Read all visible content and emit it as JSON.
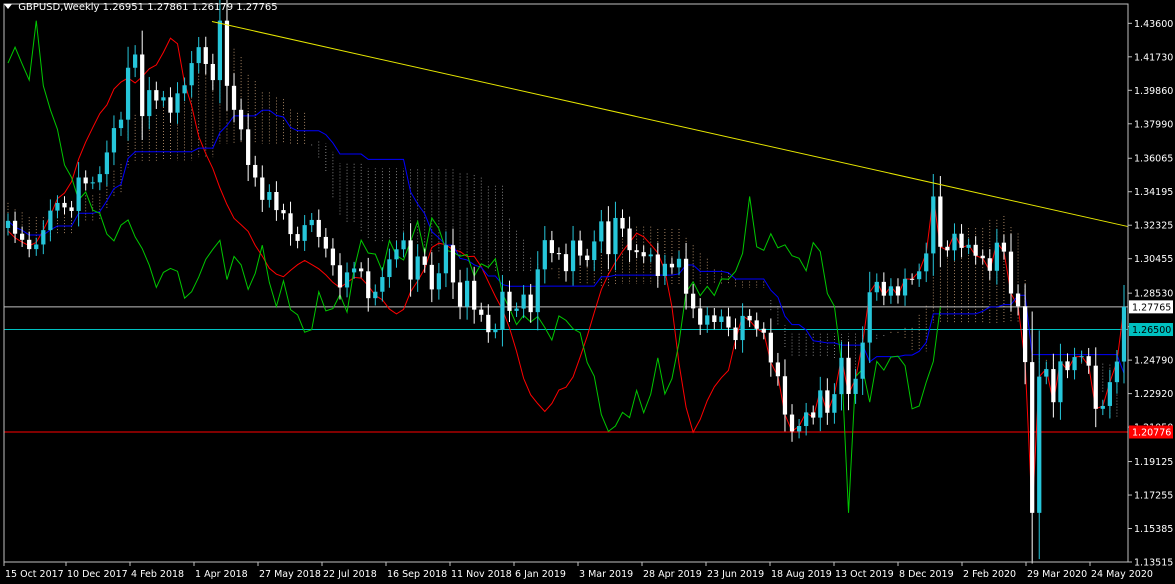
{
  "header": {
    "symbol": "GBPUSD,Weekly",
    "ohlc": "1.26951 1.27861 1.26179 1.27765"
  },
  "colors": {
    "background": "#000000",
    "frame": "#c0c0c0",
    "candle_up": "#26c6da",
    "candle_down": "#ffffff",
    "tenkan": "#ff0000",
    "kijun": "#0000ff",
    "chikou": "#00c800",
    "kumo_up": "#ffcc99",
    "kumo_down": "#c8c8c8",
    "trendline": "#e6e600",
    "bid_line": "#c0c0c0",
    "level_cyan": "#00c0c0",
    "level_red": "#ff0000"
  },
  "chart_data": {
    "type": "candlestick",
    "timeframe": "Weekly",
    "ylim": [
      1.13515,
      1.4468
    ],
    "y_ticks": [
      "1.43600",
      "1.41730",
      "1.39860",
      "1.37990",
      "1.36065",
      "1.34195",
      "1.32325",
      "1.30455",
      "1.28530",
      "1.26660",
      "1.24790",
      "1.22920",
      "1.21050",
      "1.19125",
      "1.17255",
      "1.15385",
      "1.13515"
    ],
    "x_labels": [
      "15 Oct 2017",
      "10 Dec 2017",
      "4 Feb 2018",
      "1 Apr 2018",
      "27 May 2018",
      "22 Jul 2018",
      "16 Sep 2018",
      "11 Nov 2018",
      "6 Jan 2019",
      "3 Mar 2019",
      "28 Apr 2019",
      "23 Jun 2019",
      "18 Aug 2019",
      "13 Oct 2019",
      "8 Dec 2019",
      "2 Feb 2020",
      "29 Mar 2020",
      "24 May 2020"
    ],
    "price_labels": {
      "current": "1.27765",
      "level_1": "1.26500",
      "level_2": "1.20776"
    },
    "levels": [
      {
        "name": "current",
        "value": 1.27765
      },
      {
        "name": "level_1",
        "value": 1.265
      },
      {
        "name": "level_2",
        "value": 1.20776
      }
    ],
    "trendline": [
      {
        "i": 0,
        "y": 1.437
      },
      {
        "i": 0,
        "y": 1.3225
      }
    ],
    "closes": [
      1.3257,
      1.3185,
      1.3151,
      1.3099,
      1.3125,
      1.3205,
      1.3314,
      1.3357,
      1.3332,
      1.3312,
      1.3499,
      1.3466,
      1.3472,
      1.3518,
      1.3639,
      1.3775,
      1.3822,
      1.4112,
      1.4186,
      1.3842,
      1.3987,
      1.3929,
      1.3947,
      1.3861,
      1.3969,
      1.4014,
      1.4138,
      1.4227,
      1.4133,
      1.4043,
      1.4375,
      1.4011,
      1.3877,
      1.3768,
      1.3569,
      1.3499,
      1.3374,
      1.3418,
      1.3317,
      1.3299,
      1.3183,
      1.3145,
      1.3233,
      1.3262,
      1.3167,
      1.3102,
      1.3009,
      1.2885,
      1.2969,
      1.2991,
      1.2975,
      1.2825,
      1.2861,
      1.2943,
      1.3042,
      1.3098,
      1.3148,
      1.2929,
      1.3058,
      1.3011,
      1.2874,
      1.2964,
      1.3121,
      1.2913,
      1.2778,
      1.2922,
      1.2761,
      1.2732,
      1.2635,
      1.2649,
      1.2861,
      1.2754,
      1.2767,
      1.2845,
      1.2747,
      1.2986,
      1.3149,
      1.3077,
      1.3071,
      1.2976,
      1.3147,
      1.3063,
      1.3038,
      1.3142,
      1.3254,
      1.3071,
      1.3273,
      1.3214,
      1.3093,
      1.3082,
      1.3059,
      1.3069,
      1.2949,
      1.3017,
      1.2997,
      1.3045,
      1.285,
      1.2768,
      1.2677,
      1.2729,
      1.2692,
      1.2723,
      1.2661,
      1.2591,
      1.2726,
      1.2701,
      1.2654,
      1.2632,
      1.2466,
      1.2389,
      1.2175,
      1.2081,
      1.2111,
      1.2187,
      1.2158,
      1.231,
      1.2185,
      1.2289,
      1.2492,
      1.229,
      1.2375,
      1.2577,
      1.2858,
      1.2916,
      1.2839,
      1.2891,
      1.284,
      1.2933,
      1.2931,
      1.2975,
      1.3075,
      1.3393,
      1.3112,
      1.3092,
      1.3185,
      1.3106,
      1.3123,
      1.3062,
      1.3048,
      1.2978,
      1.3135,
      1.3085,
      1.2851,
      1.278,
      1.2468,
      1.1626,
      1.2387,
      1.2429,
      1.2244,
      1.2472,
      1.2423,
      1.2496,
      1.2501,
      1.2448,
      1.2207,
      1.2223,
      1.2356,
      1.2471,
      1.2777
    ],
    "tenkan": [
      1.3201,
      1.3162,
      1.3138,
      1.3118,
      1.3136,
      1.3205,
      1.3286,
      1.3381,
      1.3412,
      1.3476,
      1.3602,
      1.3697,
      1.3778,
      1.3856,
      1.3904,
      1.3993,
      1.4032,
      1.4055,
      1.4027,
      1.4062,
      1.4106,
      1.4128,
      1.4198,
      1.4277,
      1.4246,
      1.4025,
      1.3899,
      1.3728,
      1.3632,
      1.3549,
      1.3441,
      1.3348,
      1.3271,
      1.3235,
      1.3198,
      1.312,
      1.306,
      1.2992,
      1.2959,
      1.2945,
      1.298,
      1.3012,
      1.3036,
      1.3013,
      1.2989,
      1.2955,
      1.2913,
      1.2884,
      1.2912,
      1.2941,
      1.2937,
      1.2895,
      1.284,
      1.2816,
      1.2764,
      1.2737,
      1.2762,
      1.2861,
      1.2921,
      1.299,
      1.3108,
      1.3132,
      1.3123,
      1.3095,
      1.3086,
      1.3057,
      1.3059,
      1.3001,
      1.2917,
      1.2835,
      1.2761,
      1.2659,
      1.2528,
      1.2377,
      1.2285,
      1.2236,
      1.2192,
      1.2237,
      1.2312,
      1.2328,
      1.2385,
      1.2496,
      1.2612,
      1.2745,
      1.2873,
      1.2957,
      1.3026,
      1.3086,
      1.3136,
      1.3188,
      1.3168,
      1.3125,
      1.3078,
      1.2979,
      1.2776,
      1.246,
      1.2216,
      1.2076,
      1.2148,
      1.2253,
      1.233,
      1.2381,
      1.2422
    ]
  }
}
